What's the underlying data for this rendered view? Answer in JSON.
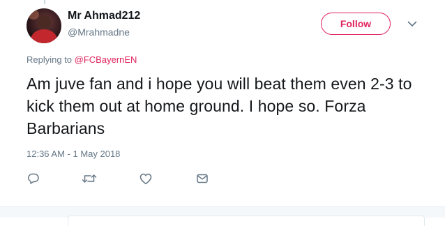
{
  "user": {
    "display_name": "Mr Ahmad212",
    "handle": "@Mrahmadne"
  },
  "follow_button": {
    "label": "Follow"
  },
  "reply_context": {
    "prefix": "Replying to ",
    "target": "@FCBayernEN"
  },
  "tweet": {
    "text": "Am juve fan and i hope you will beat them even 2-3 to kick them out at home ground. I hope so. Forza Barbarians",
    "timestamp": "12:36 AM - 1 May 2018"
  },
  "actions": [
    {
      "icon": "reply-icon"
    },
    {
      "icon": "retweet-icon"
    },
    {
      "icon": "like-icon"
    },
    {
      "icon": "direct-message-icon"
    }
  ],
  "colors": {
    "accent": "#e0245e",
    "text_primary": "#14171a",
    "text_secondary": "#657786",
    "icon": "#657786",
    "divider": "#e6ecf0"
  }
}
